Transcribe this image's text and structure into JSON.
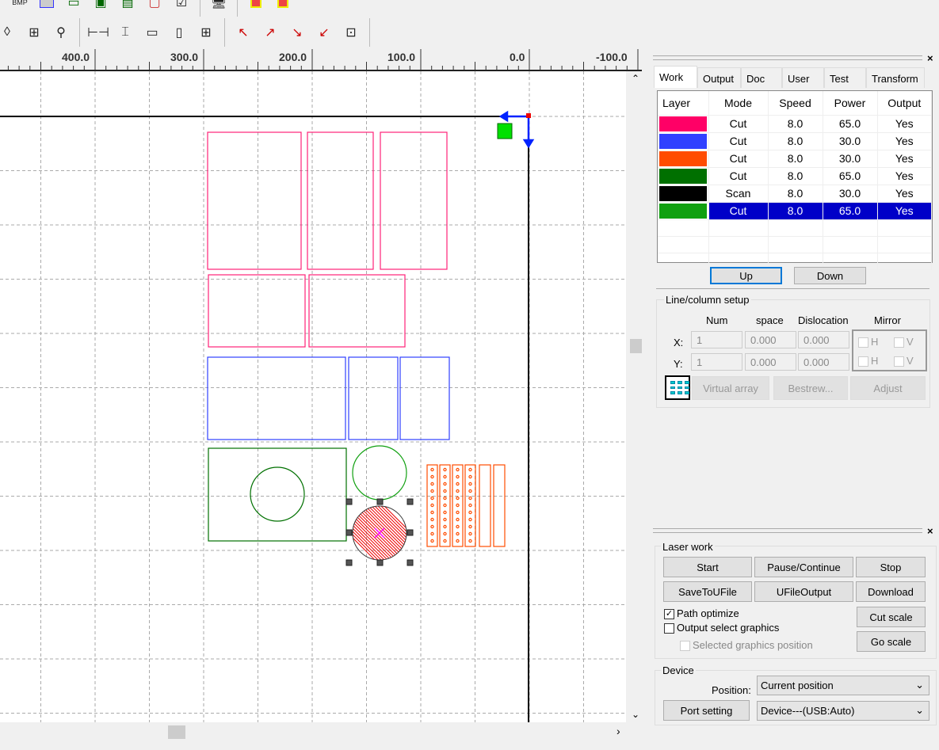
{
  "ruler": {
    "labels": [
      "400.0",
      "300.0",
      "200.0",
      "100.0",
      "0.0",
      "-100.0"
    ]
  },
  "tabs": [
    "Work",
    "Output",
    "Doc",
    "User",
    "Test",
    "Transform"
  ],
  "active_tab": "Work",
  "layers": {
    "headers": [
      "Layer",
      "Mode",
      "Speed",
      "Power",
      "Output"
    ],
    "rows": [
      {
        "color": "#ff0066",
        "mode": "Cut",
        "speed": "8.0",
        "power": "65.0",
        "output": "Yes"
      },
      {
        "color": "#3040ff",
        "mode": "Cut",
        "speed": "8.0",
        "power": "30.0",
        "output": "Yes"
      },
      {
        "color": "#ff4c00",
        "mode": "Cut",
        "speed": "8.0",
        "power": "30.0",
        "output": "Yes"
      },
      {
        "color": "#007000",
        "mode": "Cut",
        "speed": "8.0",
        "power": "65.0",
        "output": "Yes"
      },
      {
        "color": "#000000",
        "mode": "Scan",
        "speed": "8.0",
        "power": "30.0",
        "output": "Yes"
      },
      {
        "color": "#10a010",
        "mode": "Cut",
        "speed": "8.0",
        "power": "65.0",
        "output": "Yes"
      }
    ],
    "selected_row": 5
  },
  "buttons": {
    "up": "Up",
    "down": "Down"
  },
  "line_column": {
    "title": "Line/column setup",
    "num": "Num",
    "space": "space",
    "dislocation": "Dislocation",
    "mirror": "Mirror",
    "x_label": "X:",
    "y_label": "Y:",
    "x_num": "1",
    "x_space": "0.000",
    "x_disl": "0.000",
    "y_num": "1",
    "y_space": "0.000",
    "y_disl": "0.000",
    "h": "H",
    "v": "V",
    "virtual_array": "Virtual array",
    "bestrew": "Bestrew...",
    "adjust": "Adjust"
  },
  "laser_work": {
    "title": "Laser work",
    "start": "Start",
    "pause": "Pause/Continue",
    "stop": "Stop",
    "save": "SaveToUFile",
    "ufile": "UFileOutput",
    "download": "Download",
    "path_optimize": "Path optimize",
    "path_optimize_checked": true,
    "output_select": "Output select graphics",
    "output_select_checked": false,
    "selected_pos": "Selected graphics position",
    "cut_scale": "Cut scale",
    "go_scale": "Go scale"
  },
  "device": {
    "title": "Device",
    "position_label": "Position:",
    "position_value": "Current position",
    "port_setting": "Port setting",
    "device_value": "Device---(USB:Auto)"
  }
}
